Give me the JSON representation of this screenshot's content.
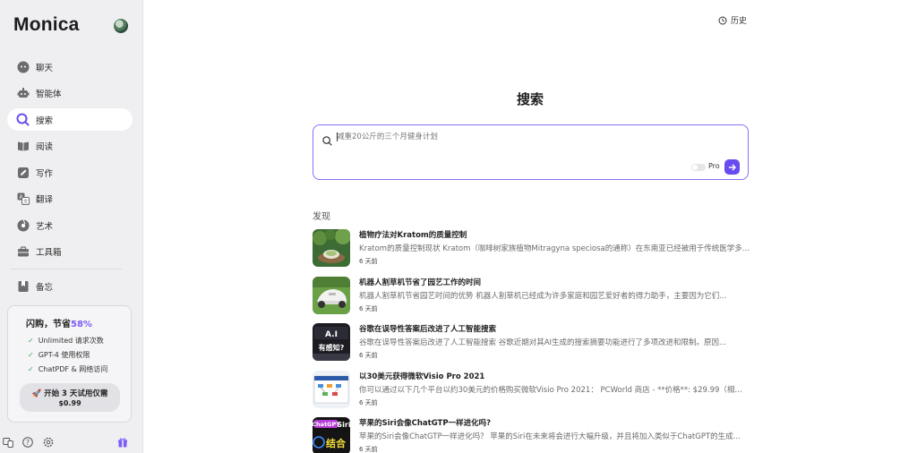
{
  "app": {
    "brand": "Monica"
  },
  "sidebar": {
    "items": [
      {
        "id": "chat",
        "label": "聊天",
        "icon": "chat-bubble-icon"
      },
      {
        "id": "agent",
        "label": "智能体",
        "icon": "robot-icon"
      },
      {
        "id": "search",
        "label": "搜索",
        "icon": "search-icon",
        "active": true
      },
      {
        "id": "read",
        "label": "阅读",
        "icon": "book-icon"
      },
      {
        "id": "write",
        "label": "写作",
        "icon": "pencil-icon"
      },
      {
        "id": "translate",
        "label": "翻译",
        "icon": "translate-icon"
      },
      {
        "id": "art",
        "label": "艺术",
        "icon": "palette-icon"
      },
      {
        "id": "tools",
        "label": "工具箱",
        "icon": "toolbox-icon"
      }
    ],
    "memo": {
      "label": "备忘",
      "icon": "bookmark-icon"
    }
  },
  "promo": {
    "title_prefix": "闪购，节省",
    "title_pct": "58%",
    "features": [
      "Unlimited 请求次数",
      "GPT-4 使用权限",
      "ChatPDF & 网络访问"
    ],
    "button_line1": "🚀 开始 3 天试用仅需",
    "button_line2": "$0.99"
  },
  "header": {
    "history_label": "历史"
  },
  "main": {
    "title": "搜索",
    "search": {
      "placeholder": "减重20公斤的三个月健身计划",
      "pro_label": "Pro"
    },
    "discover_label": "发现",
    "feed": [
      {
        "title": "植物疗法对Kratom的质量控制",
        "summary": "Kratom的质量控制现状 Kratom（咖啡树家族植物Mitragyna speciosa的通称）在东南亚已经被用于传统医学多...",
        "time": "6 天前"
      },
      {
        "title": "机器人割草机节省了园艺工作的时间",
        "summary": "机器人割草机节省园艺时间的优势 机器人割草机已经成为许多家庭和园艺爱好者的得力助手，主要因为它们...",
        "time": "6 天前"
      },
      {
        "title": "谷歌在误导性答案后改进了人工智能搜索",
        "summary": "谷歌在误导性答案后改进了人工智能搜索 谷歌近期对其AI生成的搜索摘要功能进行了多项改进和限制。原因...",
        "time": "6 天前",
        "thumb_text": "A.I 有感知？"
      },
      {
        "title": "以30美元获得微软Visio Pro 2021",
        "summary": "你可以通过以下几个平台以约30美元的价格购买微软Visio Pro 2021： PCWorld 商店 - **价格**: $29.99（相当于...",
        "time": "6 天前"
      },
      {
        "title": "苹果的Siri会像ChatGTP一样进化吗?",
        "summary": "苹果的Siri会像ChatGTP一样进化吗？ 苹果的Siri在未来将会进行大幅升级，并且将加入类似于ChatGPT的生成...",
        "time": "6 天前",
        "thumb_text": "ChatGPT Siri 结合"
      }
    ]
  }
}
